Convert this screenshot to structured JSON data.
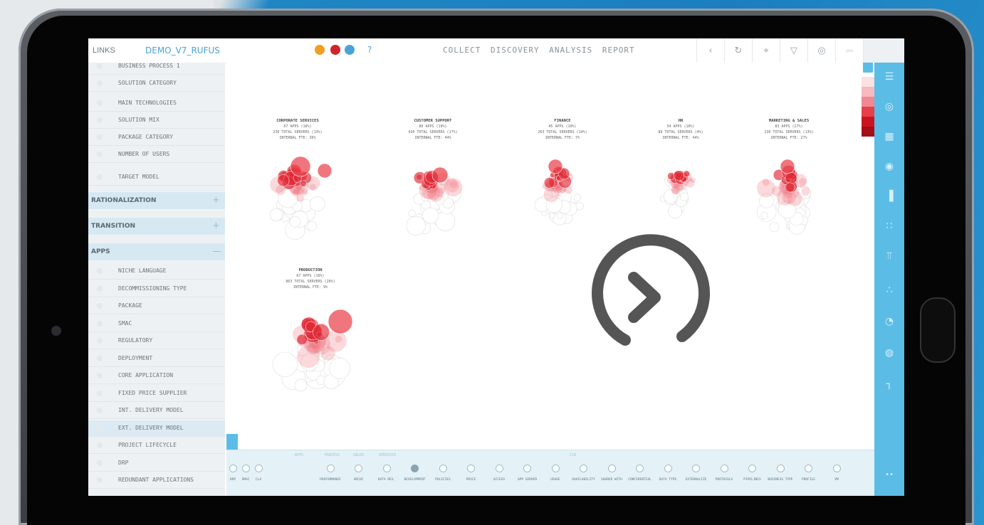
{
  "app": {
    "logo": "LINKS",
    "project": "DEMO_V7_RUFUS",
    "help": "?"
  },
  "menu": [
    "COLLECT",
    "DISCOVERY",
    "ANALYSIS",
    "REPORT"
  ],
  "toolbar_icons": [
    "undo-icon",
    "redo-icon",
    "pointer-icon",
    "filter-icon",
    "eye-icon",
    "layout-icon",
    "search-icon"
  ],
  "sidebar": {
    "items_top": [
      "BUSINESS PROCESS 1",
      "SOLUTION CATEGORY",
      "MAIN TECHNOLOGIES",
      "SOLUTION MIX",
      "PACKAGE CATEGORY",
      "NUMBER OF USERS",
      "TARGET MODEL"
    ],
    "sections": [
      {
        "label": "RATIONALIZATION",
        "toggle": "+"
      },
      {
        "label": "TRANSITION",
        "toggle": "+"
      },
      {
        "label": "APPS",
        "toggle": "—"
      }
    ],
    "items_apps": [
      "NICHE LANGUAGE",
      "DECOMMISSIONING TYPE",
      "PACKAGE",
      "SMAC",
      "REGULATORY",
      "DEPLOYMENT",
      "CORE APPLICATION",
      "FIXED PRICE SUPPLIER",
      "INT. DELIVERY MODEL",
      "EXT. DELIVERY MODEL",
      "PROJECT LIFECYCLE",
      "DRP",
      "REDUNDANT APPLICATIONS"
    ],
    "selected_app_index": 9
  },
  "clusters": [
    {
      "name": "CORPORATE SERVICES",
      "l1": "67 APPS (16%)",
      "l2": "230 TOTAL SERVERS (13%)",
      "l3": "INTERNAL FTE: 36%"
    },
    {
      "name": "CUSTOMER SUPPORT",
      "l1": "80 APPS (19%)",
      "l2": "420 TOTAL SERVERS (17%)",
      "l3": "INTERNAL FTE: 44%"
    },
    {
      "name": "FINANCE",
      "l1": "45 APPS (10%)",
      "l2": "263 TOTAL SERVERS (14%)",
      "l3": "INTERNAL FTE: 7%"
    },
    {
      "name": "HR",
      "l1": "34 APPS (10%)",
      "l2": "89 TOTAL SERVERS (4%)",
      "l3": "INTERNAL FTE: 44%"
    },
    {
      "name": "MARKETING & SALES",
      "l1": "83 APPS (27%)",
      "l2": "230 TOTAL SERVERS (13%)",
      "l3": "INTERNAL FTE: 27%"
    },
    {
      "name": "PRODUCTION",
      "l1": "67 APPS (16%)",
      "l2": "863 TOTAL SERVERS (26%)",
      "l3": "INTERNAL FTE: 9%"
    }
  ],
  "bottom": {
    "headers": [
      "APPS",
      "PROCESS",
      "SALES",
      "SERVICES",
      "CIA"
    ],
    "left_filters": [
      "DRP",
      "SMAC",
      "CLA"
    ],
    "filters": [
      "PERFORMANCE",
      "ARCHI",
      "DATA RES.",
      "DEVELOPMENT",
      "POLICIES",
      "PRICE",
      "ACCESS",
      "APP SERVER",
      "USAGE",
      "AVAILABILITY",
      "SHARED WITH",
      "CONFIDENTIAL",
      "DATA TYPE",
      "EXTERNALIZE",
      "PROTOCOLS",
      "PIPELINES",
      "BUSINESS TYPE",
      "PROFILE",
      "VM"
    ],
    "active_filter_index": 3
  },
  "right_icons": [
    "list-icon",
    "target-icon",
    "grid-icon",
    "location-icon",
    "bar-chart-icon",
    "scatter-icon",
    "hierarchy-icon",
    "network-icon",
    "gauge-icon",
    "radar-icon",
    "timeline-icon"
  ],
  "colors": {
    "accent": "#5bbde6",
    "bubble": "#e0303a",
    "link": "#4aa3d6"
  },
  "video_overlay": {
    "icon": "play-next-icon"
  }
}
